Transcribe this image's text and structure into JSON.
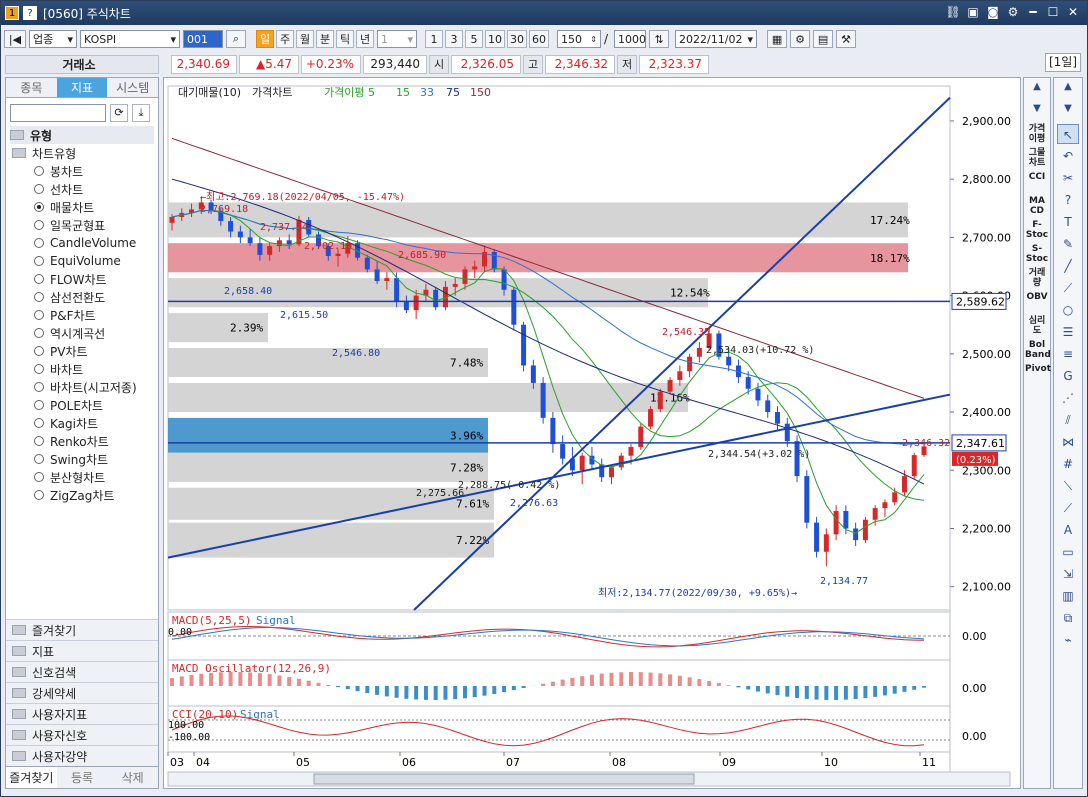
{
  "window": {
    "number": "1",
    "help": "?",
    "title": "[0560] 주식차트"
  },
  "toolbar": {
    "market_type": "업종",
    "index_name": "KOSPI",
    "code": "001",
    "periods": [
      "일",
      "주",
      "월",
      "분",
      "틱",
      "년"
    ],
    "interval_value": "1",
    "minute_values": [
      "1",
      "3",
      "5",
      "10",
      "30",
      "60"
    ],
    "count": "150",
    "count_sep": "/",
    "max_count": "1000",
    "date": "2022/11/02"
  },
  "quote": {
    "exchange": "거래소",
    "price": "2,340.69",
    "change": "▲5.47",
    "change_pct": "+0.23%",
    "volume": "293,440",
    "open_label": "시",
    "open": "2,326.05",
    "high_label": "고",
    "high": "2,346.32",
    "low_label": "저",
    "low": "2,323.37",
    "period_tag": "[1일]"
  },
  "sidebar": {
    "tabs": [
      "종목",
      "지표",
      "시스템"
    ],
    "section": "유형",
    "root": "차트유형",
    "items": [
      "봉차트",
      "선차트",
      "매물차트",
      "일목균형표",
      "CandleVolume",
      "EquiVolume",
      "FLOW차트",
      "삼선전환도",
      "P&F차트",
      "역시계곡선",
      "PV차트",
      "바차트",
      "바차트(시고저종)",
      "POLE차트",
      "Kagi차트",
      "Renko차트",
      "Swing차트",
      "분산형차트",
      "ZigZag차트"
    ],
    "selected_index": 2,
    "folders": [
      "즐겨찾기",
      "지표",
      "신호검색",
      "강세약세",
      "사용자지표",
      "사용자신호",
      "사용자강약"
    ],
    "footer": [
      "즐겨찾기",
      "등록",
      "삭제"
    ]
  },
  "right_indicators": [
    "가격\n이평",
    "그물\n차트",
    "CCI",
    "MA\nCD",
    "F-\nStoc",
    "S-\nStoc",
    "거래\n량",
    "OBV",
    "심리\n도",
    "Bol\nBand",
    "Pivot"
  ],
  "chart_data": {
    "type": "candlestick",
    "legend": [
      "대기매물(10)",
      "가격차트",
      "가격이평 5",
      "15",
      "33",
      "75",
      "150"
    ],
    "legend_colors": [
      "#222222",
      "#222222",
      "#2aa02a",
      "#2aa02a",
      "#2f74c8",
      "#1e2a78",
      "#8a2a3a"
    ],
    "y_ticks": [
      "2,900.00",
      "2,800.00",
      "2,700.00",
      "2,600.00",
      "2,500.00",
      "2,400.00",
      "2,300.00",
      "2,200.00",
      "2,100.00"
    ],
    "y_values": [
      2900,
      2800,
      2700,
      2600,
      2500,
      2400,
      2300,
      2200,
      2100
    ],
    "x_ticks": [
      "03",
      "04",
      "05",
      "06",
      "07",
      "08",
      "09",
      "10",
      "11"
    ],
    "annotations": {
      "high_note": "←최고:2,769.18(2022/04/05, -15.47%)",
      "low_note": "최저:2,134.77(2022/09/30, +9.65%)→",
      "peaks": [
        "2,769.18",
        "2,737.54",
        "2,702.10",
        "2,685.90",
        "2,658.40",
        "2,615.50",
        "2,546.80",
        "2,546.35",
        "2,534.03(+10.72 %)",
        "2,344.54(+3.02 %)",
        "2,346.32",
        "2,288.75(-0.42 %)",
        "2,275.66",
        "2,276.63",
        "2,134.77"
      ]
    },
    "volume_profile": [
      "17.24%",
      "18.17%",
      "12.54%",
      "2.39%",
      "7.48%",
      "12.16%",
      "3.96%",
      "7.28%",
      "7.61%",
      "7.22%"
    ],
    "price_tags": {
      "line": "2,589.62",
      "last": "2,347.61",
      "pct": "(0.23%)"
    },
    "macd": {
      "label": "MACD(5,25,5)",
      "signal": "Signal",
      "value": "0.00",
      "zero": "0.00"
    },
    "macd_osc": {
      "label": "MACD Oscillator(12,26,9)",
      "value": "0.00"
    },
    "cci": {
      "label": "CCI(20,10)",
      "signal": "Signal",
      "upper": "100.00",
      "lower": "-100.00",
      "value": "0.00"
    },
    "candles": [
      [
        2725,
        2740,
        2712,
        2735
      ],
      [
        2735,
        2750,
        2728,
        2742
      ],
      [
        2742,
        2758,
        2735,
        2748
      ],
      [
        2748,
        2769,
        2740,
        2760
      ],
      [
        2760,
        2765,
        2740,
        2745
      ],
      [
        2745,
        2750,
        2720,
        2728
      ],
      [
        2728,
        2735,
        2700,
        2710
      ],
      [
        2710,
        2720,
        2690,
        2700
      ],
      [
        2700,
        2715,
        2685,
        2690
      ],
      [
        2690,
        2700,
        2660,
        2670
      ],
      [
        2670,
        2690,
        2660,
        2685
      ],
      [
        2685,
        2700,
        2675,
        2695
      ],
      [
        2695,
        2705,
        2680,
        2688
      ],
      [
        2688,
        2737,
        2685,
        2730
      ],
      [
        2730,
        2735,
        2700,
        2705
      ],
      [
        2705,
        2710,
        2680,
        2685
      ],
      [
        2685,
        2690,
        2660,
        2668
      ],
      [
        2668,
        2680,
        2650,
        2672
      ],
      [
        2672,
        2702,
        2665,
        2690
      ],
      [
        2690,
        2695,
        2660,
        2665
      ],
      [
        2665,
        2670,
        2640,
        2645
      ],
      [
        2645,
        2660,
        2620,
        2625
      ],
      [
        2625,
        2640,
        2610,
        2630
      ],
      [
        2630,
        2640,
        2580,
        2590
      ],
      [
        2590,
        2600,
        2570,
        2575
      ],
      [
        2575,
        2610,
        2560,
        2600
      ],
      [
        2600,
        2620,
        2590,
        2610
      ],
      [
        2610,
        2615,
        2575,
        2580
      ],
      [
        2580,
        2625,
        2575,
        2615
      ],
      [
        2615,
        2630,
        2600,
        2620
      ],
      [
        2620,
        2650,
        2610,
        2645
      ],
      [
        2645,
        2660,
        2630,
        2650
      ],
      [
        2650,
        2686,
        2640,
        2675
      ],
      [
        2675,
        2680,
        2640,
        2645
      ],
      [
        2645,
        2650,
        2600,
        2610
      ],
      [
        2610,
        2615,
        2540,
        2550
      ],
      [
        2550,
        2555,
        2470,
        2480
      ],
      [
        2480,
        2490,
        2440,
        2450
      ],
      [
        2450,
        2460,
        2380,
        2390
      ],
      [
        2390,
        2400,
        2330,
        2345
      ],
      [
        2345,
        2360,
        2310,
        2320
      ],
      [
        2320,
        2340,
        2290,
        2300
      ],
      [
        2300,
        2330,
        2276,
        2325
      ],
      [
        2325,
        2340,
        2300,
        2310
      ],
      [
        2310,
        2320,
        2280,
        2288
      ],
      [
        2288,
        2310,
        2276,
        2305
      ],
      [
        2305,
        2330,
        2300,
        2325
      ],
      [
        2325,
        2345,
        2310,
        2340
      ],
      [
        2340,
        2380,
        2335,
        2375
      ],
      [
        2375,
        2410,
        2370,
        2405
      ],
      [
        2405,
        2440,
        2400,
        2435
      ],
      [
        2435,
        2460,
        2430,
        2455
      ],
      [
        2455,
        2480,
        2445,
        2470
      ],
      [
        2470,
        2500,
        2460,
        2495
      ],
      [
        2495,
        2520,
        2485,
        2510
      ],
      [
        2510,
        2546,
        2505,
        2535
      ],
      [
        2535,
        2540,
        2490,
        2495
      ],
      [
        2495,
        2510,
        2470,
        2480
      ],
      [
        2480,
        2490,
        2450,
        2460
      ],
      [
        2460,
        2470,
        2430,
        2440
      ],
      [
        2440,
        2450,
        2410,
        2420
      ],
      [
        2420,
        2430,
        2390,
        2400
      ],
      [
        2400,
        2410,
        2370,
        2380
      ],
      [
        2380,
        2390,
        2340,
        2350
      ],
      [
        2350,
        2360,
        2280,
        2290
      ],
      [
        2290,
        2300,
        2200,
        2210
      ],
      [
        2210,
        2220,
        2150,
        2160
      ],
      [
        2160,
        2200,
        2135,
        2190
      ],
      [
        2190,
        2240,
        2180,
        2230
      ],
      [
        2230,
        2240,
        2190,
        2200
      ],
      [
        2200,
        2210,
        2170,
        2180
      ],
      [
        2180,
        2220,
        2175,
        2215
      ],
      [
        2215,
        2240,
        2205,
        2235
      ],
      [
        2235,
        2250,
        2220,
        2245
      ],
      [
        2245,
        2270,
        2240,
        2262
      ],
      [
        2262,
        2300,
        2255,
        2290
      ],
      [
        2290,
        2330,
        2285,
        2326
      ],
      [
        2326,
        2347,
        2323,
        2341
      ]
    ]
  }
}
